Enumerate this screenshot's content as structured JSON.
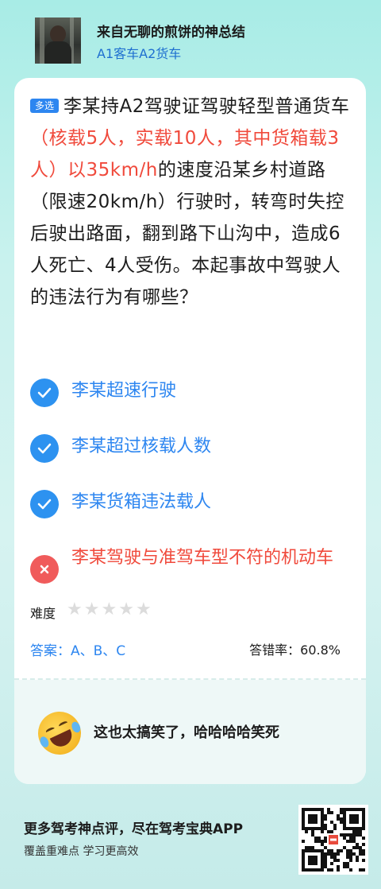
{
  "header": {
    "title": "来自无聊的煎饼的神总结",
    "subtitle": "A1客车A2货车"
  },
  "question": {
    "badge": "多选",
    "part1": "李某持A2驾驶证驾驶轻型普通货车",
    "highlight": "（核载5人，实载10人，其中货箱载3人）以35km/h",
    "part2": "的速度沿某乡村道路（限速20km/h）行驶时，转弯时失控后驶出路面，翻到路下山沟中，造成6人死亡、4人受伤。本起事故中驾驶人的违法行为有哪些？"
  },
  "options": [
    {
      "text": "李某超速行驶",
      "status": "correct"
    },
    {
      "text": "李某超过核载人数",
      "status": "correct"
    },
    {
      "text": "李某货箱违法载人",
      "status": "correct"
    },
    {
      "text": "李某驾驶与准驾车型不符的机动车",
      "status": "wrong"
    }
  ],
  "difficulty": {
    "label": "难度",
    "stars_total": 5,
    "stars_filled": 0
  },
  "answer": {
    "text": "答案：A、B、C"
  },
  "error_rate": {
    "text": "答错率：60.8%"
  },
  "comment": {
    "icon": "rofl-emoji-icon",
    "text": "这也太搞笑了，哈哈哈哈笑死"
  },
  "footer": {
    "title": "更多驾考神点评，尽在驾考宝典APP",
    "subtitle": "覆盖重难点 学习更高效"
  },
  "colors": {
    "accent": "#2d86f0",
    "wrong": "#f04a3c",
    "correct_icon": "#2d92f0",
    "wrong_icon": "#f05b5b"
  }
}
